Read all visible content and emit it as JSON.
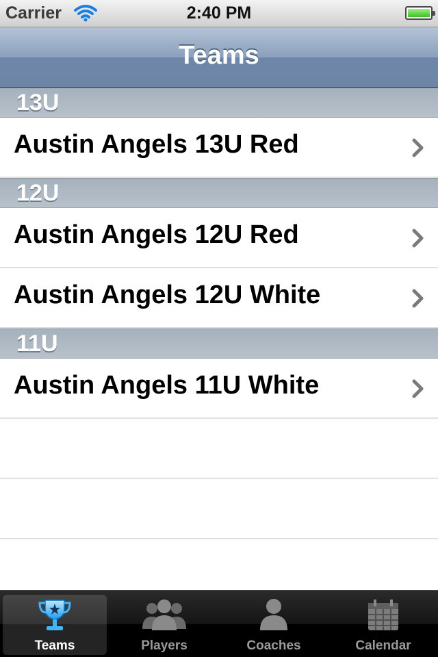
{
  "status_bar": {
    "carrier": "Carrier",
    "time": "2:40 PM"
  },
  "nav": {
    "title": "Teams"
  },
  "sections": [
    {
      "header": "13U",
      "rows": [
        "Austin Angels 13U Red"
      ]
    },
    {
      "header": "12U",
      "rows": [
        "Austin Angels 12U Red",
        "Austin Angels 12U White"
      ]
    },
    {
      "header": "11U",
      "rows": [
        "Austin Angels 11U White"
      ]
    }
  ],
  "tabs": [
    {
      "label": "Teams",
      "icon": "trophy-icon",
      "selected": true
    },
    {
      "label": "Players",
      "icon": "group-icon",
      "selected": false
    },
    {
      "label": "Coaches",
      "icon": "person-icon",
      "selected": false
    },
    {
      "label": "Calendar",
      "icon": "calendar-icon",
      "selected": false
    }
  ],
  "colors": {
    "nav_bar": "#7f96b5",
    "section_header": "#adb7c2",
    "tab_selected": "#3db6ff"
  }
}
